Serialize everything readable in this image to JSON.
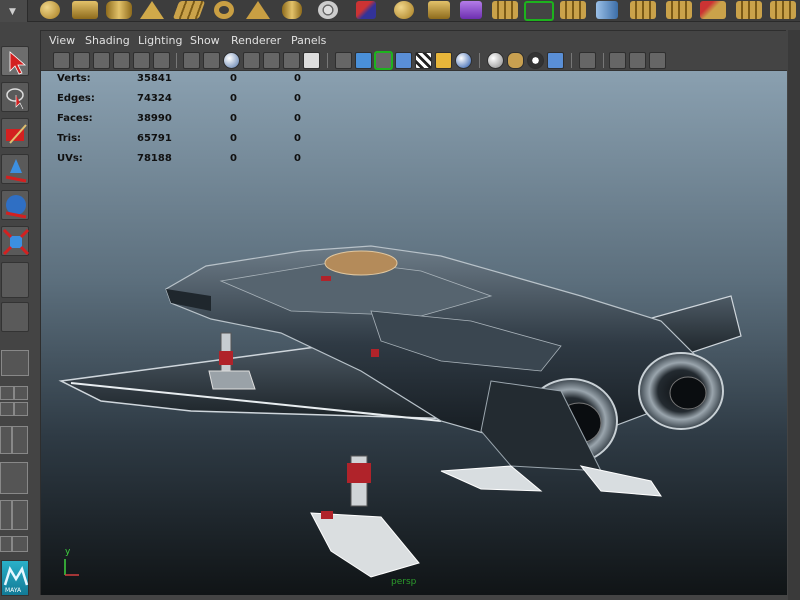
{
  "viewport": {
    "menus": [
      "View",
      "Shading",
      "Lighting",
      "Show",
      "Renderer",
      "Panels"
    ],
    "heads_up": [
      {
        "label": "Verts:",
        "total": "35841",
        "selected": "0",
        "triangles": "0"
      },
      {
        "label": "Edges:",
        "total": "74324",
        "selected": "0",
        "triangles": "0"
      },
      {
        "label": "Faces:",
        "total": "38990",
        "selected": "0",
        "triangles": "0"
      },
      {
        "label": "Tris:",
        "total": "65791",
        "selected": "0",
        "triangles": "0"
      },
      {
        "label": "UVs:",
        "total": "78188",
        "selected": "0",
        "triangles": "0"
      }
    ],
    "camera_name": "persp",
    "axis_label": "y"
  },
  "logo": {
    "text": "MAYA"
  },
  "colors": {
    "ui_background": "#444444",
    "highlight": "#1db31d",
    "camera_label": "#2b9a2b",
    "hull": "#2f3a44",
    "accent_red": "#b0232a"
  },
  "icons": {
    "shelf": [
      "sphere-icon",
      "cube-icon",
      "cylinder-icon",
      "cone-icon",
      "plane-icon",
      "torus-icon",
      "nurbs-icon",
      "move-icon",
      "snap-icon",
      "curve-icon",
      "deform-icon",
      "lattice-icon",
      "render-icon"
    ],
    "viewport_bar": [
      "select-camera-icon",
      "camera-attributes-icon",
      "bookmark-icon",
      "image-plane-icon",
      "2d-pan-icon",
      "grease-pencil-icon",
      "grid-icon",
      "film-gate-icon",
      "resolution-gate-icon",
      "gate-mask-icon",
      "field-chart-icon",
      "safe-action-icon",
      "wireframe-icon",
      "smooth-shade-icon",
      "wireframe-on-shaded-icon",
      "xray-icon",
      "texture-icon",
      "lights-icon",
      "shadows-icon",
      "ambient-occlusion-icon",
      "motion-blur-icon",
      "depth-of-field-icon",
      "isolate-select-icon",
      "single-view-icon",
      "layout-icon",
      "hypershade-icon"
    ]
  }
}
